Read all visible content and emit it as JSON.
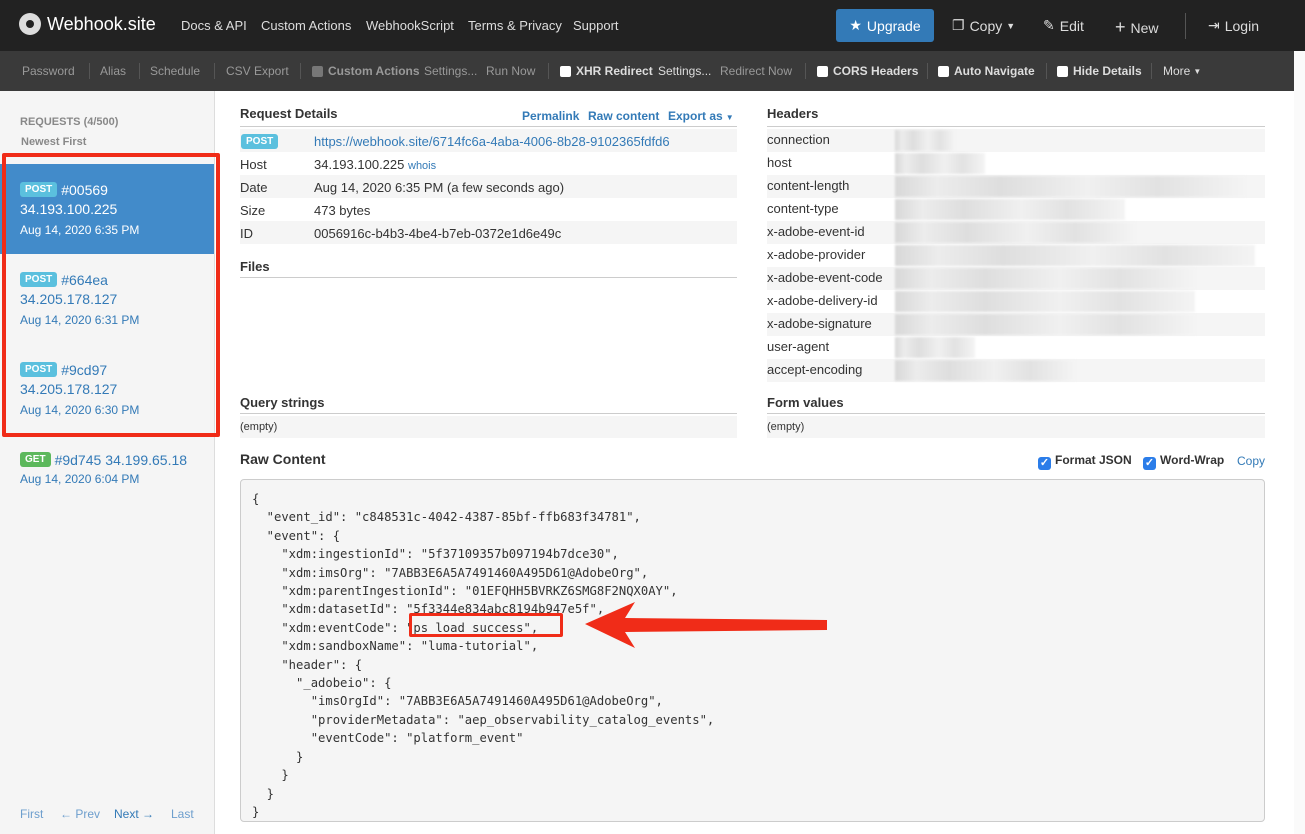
{
  "nav": {
    "brand": "Webhook.site",
    "links": [
      "Docs & API",
      "Custom Actions",
      "WebhookScript",
      "Terms & Privacy",
      "Support"
    ],
    "upgrade": "Upgrade",
    "copy": "Copy",
    "edit": "Edit",
    "new": "New",
    "login": "Login"
  },
  "subnav": {
    "password": "Password",
    "alias": "Alias",
    "schedule": "Schedule",
    "csv": "CSV Export",
    "custom_actions": "Custom Actions",
    "settings1": "Settings...",
    "run_now": "Run Now",
    "xhr": "XHR Redirect",
    "settings2": "Settings...",
    "redirect_now": "Redirect Now",
    "cors": "CORS Headers",
    "auto_nav": "Auto Navigate",
    "hide_details": "Hide Details",
    "more": "More"
  },
  "sidebar": {
    "title": "REQUESTS (4/500)",
    "sort": "Newest First",
    "requests": [
      {
        "method": "POST",
        "id": "#00569",
        "ip": "34.193.100.225",
        "date": "Aug 14, 2020 6:35 PM"
      },
      {
        "method": "POST",
        "id": "#664ea",
        "ip": "34.205.178.127",
        "date": "Aug 14, 2020 6:31 PM"
      },
      {
        "method": "POST",
        "id": "#9cd97",
        "ip": "34.205.178.127",
        "date": "Aug 14, 2020 6:30 PM"
      },
      {
        "method": "GET",
        "id": "#9d745",
        "ip": "34.199.65.18",
        "date": "Aug 14, 2020 6:04 PM"
      }
    ],
    "pager": {
      "first": "First",
      "prev": "← Prev",
      "next": "Next →",
      "last": "Last"
    }
  },
  "details": {
    "title": "Request Details",
    "permalink": "Permalink",
    "raw_content": "Raw content",
    "export_as": "Export as",
    "method": "POST",
    "url": "https://webhook.site/6714fc6a-4aba-4006-8b28-9102365fdfd6",
    "host_label": "Host",
    "host": "34.193.100.225",
    "whois": "whois",
    "date_label": "Date",
    "date": "Aug 14, 2020 6:35 PM (a few seconds ago)",
    "size_label": "Size",
    "size": "473 bytes",
    "id_label": "ID",
    "id": "0056916c-b4b3-4be4-b7eb-0372e1d6e49c"
  },
  "files": {
    "title": "Files"
  },
  "headers": {
    "title": "Headers",
    "keys": [
      "connection",
      "host",
      "content-length",
      "content-type",
      "x-adobe-event-id",
      "x-adobe-provider",
      "x-adobe-event-code",
      "x-adobe-delivery-id",
      "x-adobe-signature",
      "user-agent",
      "accept-encoding"
    ]
  },
  "query": {
    "title": "Query strings",
    "value": "(empty)"
  },
  "form": {
    "title": "Form values",
    "value": "(empty)"
  },
  "raw": {
    "title": "Raw Content",
    "format_json": "Format JSON",
    "word_wrap": "Word-Wrap",
    "copy": "Copy",
    "body": "{\n  \"event_id\": \"c848531c-4042-4387-85bf-ffb683f34781\",\n  \"event\": {\n    \"xdm:ingestionId\": \"5f37109357b097194b7dce30\",\n    \"xdm:imsOrg\": \"7ABB3E6A5A7491460A495D61@AdobeOrg\",\n    \"xdm:parentIngestionId\": \"01EFQHH5BVRKZ6SMG8F2NQX0AY\",\n    \"xdm:datasetId\": \"5f3344e834abc8194b947e5f\",\n    \"xdm:eventCode\": \"ps_load_success\",\n    \"xdm:sandboxName\": \"luma-tutorial\",\n    \"header\": {\n      \"_adobeio\": {\n        \"imsOrgId\": \"7ABB3E6A5A7491460A495D61@AdobeOrg\",\n        \"providerMetadata\": \"aep_observability_catalog_events\",\n        \"eventCode\": \"platform_event\"\n      }\n    }\n  }\n}"
  },
  "colors": {
    "annotation": "#f02c18",
    "accent": "#337ab7"
  }
}
